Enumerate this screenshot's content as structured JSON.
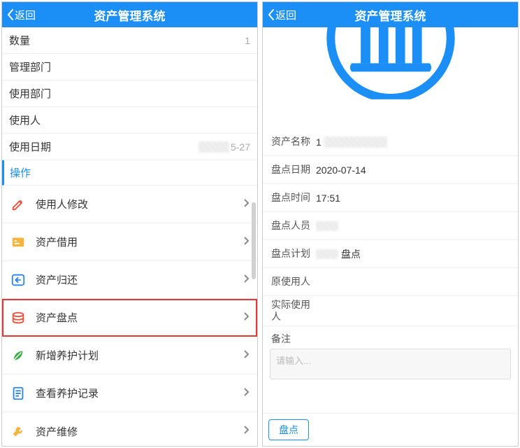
{
  "left": {
    "back": "返回",
    "title": "资产管理系统",
    "info": {
      "qty_label": "数量",
      "qty_value": "1",
      "mgmt_dept_label": "管理部门",
      "use_dept_label": "使用部门",
      "user_label": "使用人",
      "use_date_label": "使用日期",
      "use_date_suffix": "5-27"
    },
    "section": "操作",
    "actions": {
      "modify_user": "使用人修改",
      "borrow": "资产借用",
      "return": "资产归还",
      "inventory": "资产盘点",
      "new_plan": "新增养护计划",
      "view_records": "查看养护记录",
      "repair": "资产维修"
    }
  },
  "right": {
    "back": "返回",
    "title": "资产管理系统",
    "form": {
      "asset_name_label": "资产名称",
      "asset_name_prefix": "1",
      "date_label": "盘点日期",
      "date_value": "2020-07-14",
      "time_label": "盘点时间",
      "time_value": "17:51",
      "staff_label": "盘点人员",
      "plan_label": "盘点计划",
      "plan_suffix": "盘点",
      "orig_user_label": "原使用人",
      "actual_user_label": "实际使用人",
      "remark_label": "备注",
      "remark_placeholder": "请输入..."
    },
    "submit": "盘点"
  }
}
